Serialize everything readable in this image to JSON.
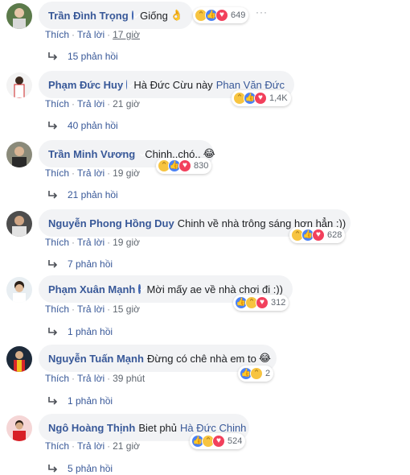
{
  "accent": "#385898",
  "comments": [
    {
      "name": "Trần Đình Trọng",
      "verified": true,
      "text": "Giống",
      "mention": "",
      "inline_emoji": "👌",
      "reactions": [
        "haha",
        "like",
        "love"
      ],
      "reaction_count": "649",
      "like_label": "Thích",
      "reply_label": "Trả lời",
      "time": "17 giờ",
      "replies": "15 phản hồi",
      "show_more": "···"
    },
    {
      "name": "Phạm Đức Huy",
      "verified": true,
      "text": "Hà Đức Cừu này",
      "mention": "Phan Văn Đức",
      "inline_emoji": "",
      "reactions": [
        "haha",
        "like",
        "love"
      ],
      "reaction_count": "1,4K",
      "like_label": "Thích",
      "reply_label": "Trả lời",
      "time": "21 giờ",
      "replies": "40 phản hồi"
    },
    {
      "name": "Trần Minh Vương",
      "verified": true,
      "text": "Chinh..chó..",
      "mention": "",
      "inline_emoji": "😂",
      "reactions": [
        "haha",
        "like",
        "love"
      ],
      "reaction_count": "830",
      "like_label": "Thích",
      "reply_label": "Trả lời",
      "time": "19 giờ",
      "replies": "21 phản hồi"
    },
    {
      "name": "Nguyễn Phong Hồng Duy",
      "verified": false,
      "text": "Chinh về nhà trông sáng hơn hẳn :))",
      "mention": "",
      "inline_emoji": "",
      "reactions": [
        "haha",
        "like",
        "love"
      ],
      "reaction_count": "628",
      "like_label": "Thích",
      "reply_label": "Trả lời",
      "time": "19 giờ",
      "replies": "7 phản hồi"
    },
    {
      "name": "Phạm Xuân Mạnh",
      "verified": true,
      "text": "Mời mấy ae về nhà chơi đi :))",
      "mention": "",
      "inline_emoji": "",
      "reactions": [
        "like",
        "haha",
        "love"
      ],
      "reaction_count": "312",
      "like_label": "Thích",
      "reply_label": "Trả lời",
      "time": "15 giờ",
      "replies": "1 phản hồi"
    },
    {
      "name": "Nguyễn Tuấn Mạnh",
      "verified": false,
      "text": "Đừng có chê nhà em to",
      "mention": "",
      "inline_emoji": "😂",
      "reactions": [
        "like",
        "haha"
      ],
      "reaction_count": "2",
      "like_label": "Thích",
      "reply_label": "Trả lời",
      "time": "39 phút",
      "replies": "1 phản hồi"
    },
    {
      "name": "Ngô Hoàng Thịnh",
      "verified": false,
      "text": "Biet phủ",
      "mention": "Hà Đức Chinh",
      "inline_emoji": "",
      "reactions": [
        "like",
        "haha",
        "love"
      ],
      "reaction_count": "524",
      "like_label": "Thích",
      "reply_label": "Trả lời",
      "time": "21 giờ",
      "replies": "5 phản hồi"
    }
  ]
}
